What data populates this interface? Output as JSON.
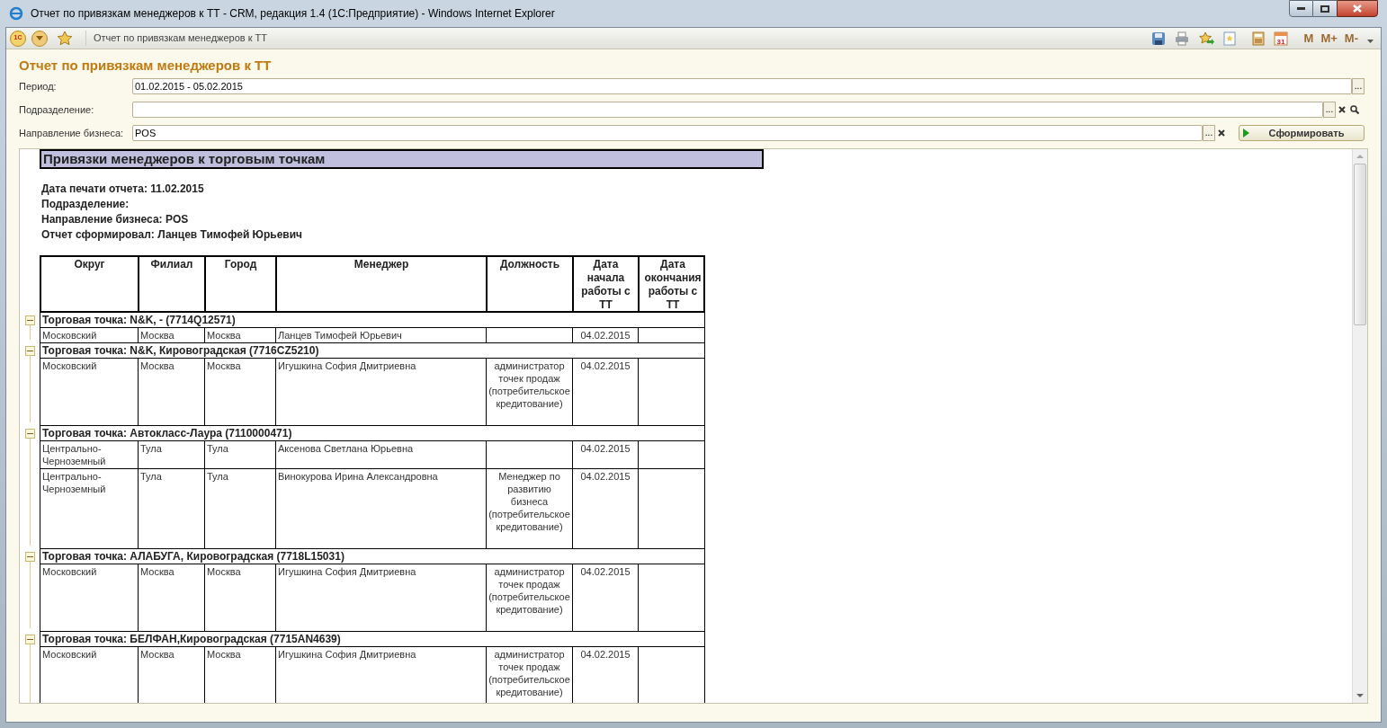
{
  "window": {
    "title": "Отчет по привязкам менеджеров к ТТ - CRM, редакция 1.4 (1С:Предприятие) - Windows Internet Explorer"
  },
  "toolbar": {
    "logo_text": "1С",
    "page_title": "Отчет по привязкам менеджеров к ТТ",
    "calendar_day": "31",
    "memory_buttons": [
      "M",
      "M+",
      "M-"
    ]
  },
  "form": {
    "heading": "Отчет по привязкам менеджеров к ТТ",
    "fields": [
      {
        "label": "Период:",
        "value": "01.02.2015 - 05.02.2015",
        "kind": "select"
      },
      {
        "label": "Подразделение:",
        "kind": "search"
      },
      {
        "label": "Направление бизнеса:",
        "value": "POS",
        "kind": "clear"
      }
    ],
    "ellipsis": "...",
    "run_button": "Сформировать"
  },
  "report": {
    "title": "Привязки менеджеров к торговым точкам",
    "info": [
      "Дата печати отчета: 11.02.2015",
      "Подразделение:",
      "Направление бизнеса: POS",
      "Отчет сформировал: Ланцев Тимофей Юрьевич"
    ],
    "columns": [
      "Округ",
      "Филиал",
      "Город",
      "Менеджер",
      "Должность",
      "Дата начала работы с ТТ",
      "Дата окончания работы с ТТ"
    ],
    "groups": [
      {
        "title": "Торговая точка: N&K, - (7714Q12571)",
        "expanded": true,
        "rows": [
          [
            "Московский",
            "Москва",
            "Москва",
            "Ланцев Тимофей Юрьевич",
            "",
            "04.02.2015",
            ""
          ]
        ]
      },
      {
        "title": "Торговая точка: N&K, Кировоградская (7716CZ5210)",
        "expanded": true,
        "rows": [
          [
            "Московский",
            "Москва",
            "Москва",
            "Игушкина София Дмитриевна",
            "администратор точек продаж (потребительское кредитование)",
            "04.02.2015",
            ""
          ]
        ]
      },
      {
        "title": "Торговая точка: Автокласс-Лаура (7110000471)",
        "expanded": true,
        "rows": [
          [
            "Центрально-Черноземный",
            "Тула",
            "Тула",
            "Аксенова Светлана Юрьевна",
            "",
            "04.02.2015",
            ""
          ],
          [
            "Центрально-Черноземный",
            "Тула",
            "Тула",
            "Винокурова Ирина Александровна",
            "Менеджер по развитию бизнеса (потребительское кредитование)",
            "04.02.2015",
            ""
          ]
        ]
      },
      {
        "title": "Торговая точка: АЛАБУГА, Кировоградская (7718L15031)",
        "expanded": true,
        "rows": [
          [
            "Московский",
            "Москва",
            "Москва",
            "Игушкина София Дмитриевна",
            "администратор точек продаж (потребительское кредитование)",
            "04.02.2015",
            ""
          ]
        ]
      },
      {
        "title": "Торговая точка: БЕЛФАН,Кировоградская (7715AN4639)",
        "expanded": true,
        "rows": [
          [
            "Московский",
            "Москва",
            "Москва",
            "Игушкина София Дмитриевна",
            "администратор точек продаж (потребительское кредитование)",
            "04.02.2015",
            ""
          ]
        ]
      }
    ]
  }
}
